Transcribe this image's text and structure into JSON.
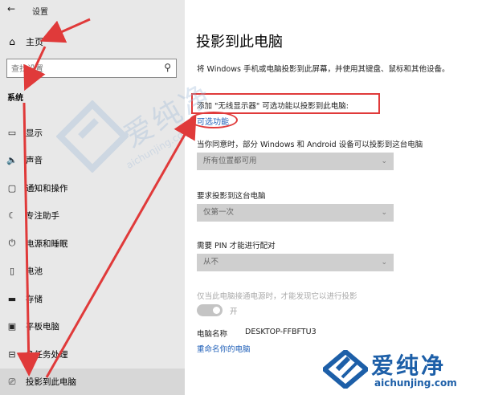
{
  "window": {
    "title": "设置"
  },
  "sidebar": {
    "home_label": "主页",
    "search_placeholder": "查找设置",
    "section_title": "系统",
    "items": [
      {
        "icon": "display-icon",
        "glyph": "▭",
        "label": "显示"
      },
      {
        "icon": "sound-icon",
        "glyph": "🔈",
        "label": "声音"
      },
      {
        "icon": "notification-icon",
        "glyph": "▢",
        "label": "通知和操作"
      },
      {
        "icon": "focus-assist-icon",
        "glyph": "☾",
        "label": "专注助手"
      },
      {
        "icon": "power-icon",
        "glyph": "⏻",
        "label": "电源和睡眠"
      },
      {
        "icon": "battery-icon",
        "glyph": "▯",
        "label": "电池"
      },
      {
        "icon": "storage-icon",
        "glyph": "▬",
        "label": "存储"
      },
      {
        "icon": "tablet-icon",
        "glyph": "▣",
        "label": "平板电脑"
      },
      {
        "icon": "multitasking-icon",
        "glyph": "⊟",
        "label": "多任务处理"
      },
      {
        "icon": "project-icon",
        "glyph": "⎚",
        "label": "投影到此电脑"
      }
    ]
  },
  "main": {
    "title": "投影到此电脑",
    "description": "将 Windows 手机或电脑投影到此屏幕，并使用其键盘、鼠标和其他设备。",
    "add_hint": "添加 \"无线显示器\" 可选功能以投影到此电脑:",
    "optional_link": "可选功能",
    "allow_label": "当你同意时，部分 Windows 和 Android 设备可以投影到这台电脑",
    "allow_value": "所有位置都可用",
    "ask_label": "要求投影到这台电脑",
    "ask_value": "仅第一次",
    "pin_label": "需要 PIN 才能进行配对",
    "pin_value": "从不",
    "power_only_label": "仅当此电脑接通电源时，才能发现它以进行投影",
    "toggle_label": "开",
    "pc_name_label": "电脑名称",
    "pc_name_value": "DESKTOP-FFBFTU3",
    "rename_link": "重命名你的电脑"
  },
  "watermark": {
    "brand": "爱纯净",
    "url": "aichunjing.com"
  },
  "colors": {
    "annotation": "#e03a3a",
    "link": "#1f5fb8",
    "brand": "#1d5fa8"
  }
}
